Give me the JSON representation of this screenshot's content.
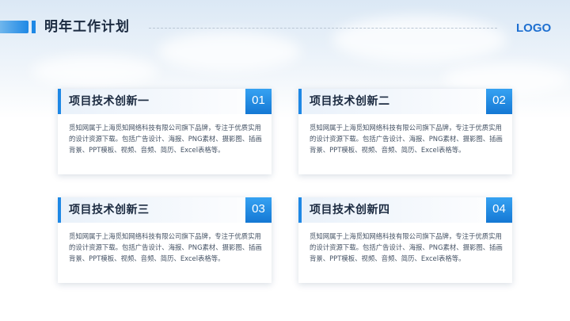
{
  "header": {
    "title": "明年工作计划",
    "logo": "LOGO"
  },
  "colors": {
    "accent": "#1e88e5",
    "title_text": "#1b2a40",
    "body_text": "#445264"
  },
  "cards": [
    {
      "title": "项目技术创新一",
      "number": "01",
      "body": "觅知网属于上海觅知网络科技有限公司旗下品牌，专注于优质实用的设计资源下载。包括广告设计、海报、PNG素材、摄影图、插画背景、PPT模板、视频、音频、简历、Excel表格等。"
    },
    {
      "title": "项目技术创新二",
      "number": "02",
      "body": "觅知网属于上海觅知网络科技有限公司旗下品牌，专注于优质实用的设计资源下载。包括广告设计、海报、PNG素材、摄影图、插画背景、PPT模板、视频、音频、简历、Excel表格等。"
    },
    {
      "title": "项目技术创新三",
      "number": "03",
      "body": "觅知网属于上海觅知网络科技有限公司旗下品牌，专注于优质实用的设计资源下载。包括广告设计、海报、PNG素材、摄影图、插画背景、PPT模板、视频、音频、简历、Excel表格等。"
    },
    {
      "title": "项目技术创新四",
      "number": "04",
      "body": "觅知网属于上海觅知网络科技有限公司旗下品牌，专注于优质实用的设计资源下载。包括广告设计、海报、PNG素材、摄影图、插画背景、PPT模板、视频、音频、简历、Excel表格等。"
    }
  ]
}
